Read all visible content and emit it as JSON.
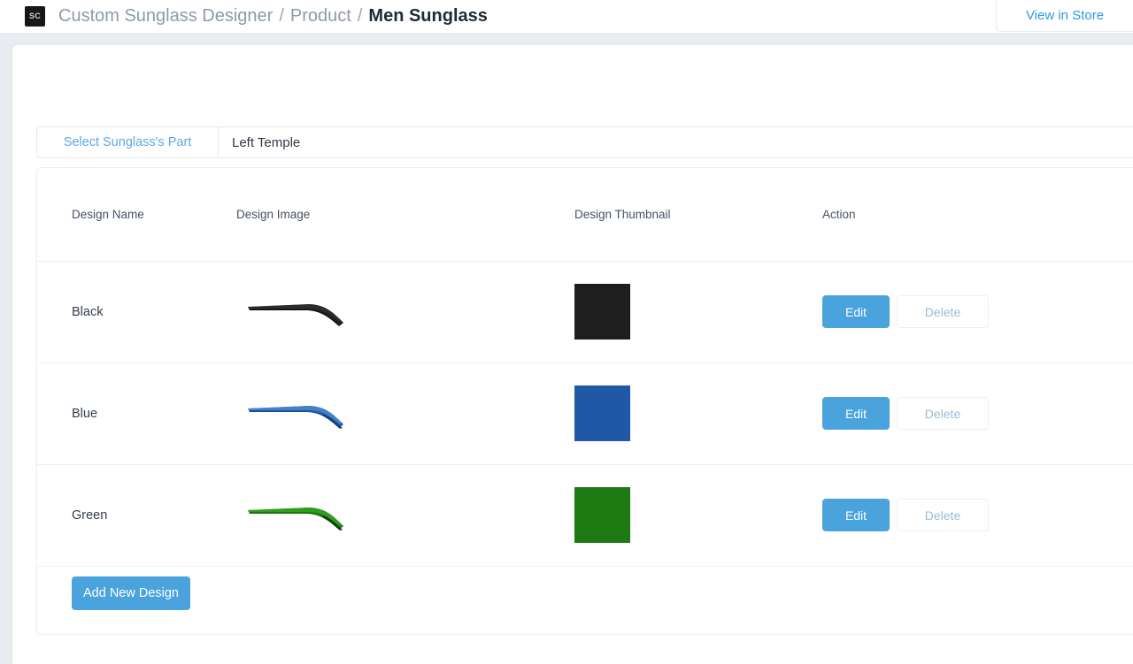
{
  "header": {
    "logo_text": "SC",
    "breadcrumb": {
      "app": "Custom Sunglass Designer",
      "sep1": "/",
      "section": "Product",
      "sep2": "/",
      "current": "Men Sunglass"
    },
    "view_in_store_label": "View in Store"
  },
  "part_selector": {
    "label": "Select Sunglass's Part",
    "value": "Left Temple"
  },
  "table": {
    "columns": {
      "name": "Design Name",
      "image": "Design Image",
      "thumbnail": "Design Thumbnail",
      "action": "Action"
    },
    "rows": [
      {
        "name": "Black",
        "image_alt": "left-temple-black",
        "thumbnail_color": "#1e1e1e",
        "edit_label": "Edit",
        "delete_label": "Delete"
      },
      {
        "name": "Blue",
        "image_alt": "left-temple-blue",
        "thumbnail_color": "#1f58a6",
        "edit_label": "Edit",
        "delete_label": "Delete"
      },
      {
        "name": "Green",
        "image_alt": "left-temple-green",
        "thumbnail_color": "#1d7a12",
        "edit_label": "Edit",
        "delete_label": "Delete"
      }
    ]
  },
  "footer": {
    "add_new_design_label": "Add New Design"
  },
  "colors": {
    "accent_blue": "#4aa3dc",
    "link_blue": "#2e9ae0",
    "page_background": "#e9edf1",
    "black_design": "#1e1e1e",
    "blue_design": "#1f58a6",
    "green_design": "#1d7a12"
  }
}
